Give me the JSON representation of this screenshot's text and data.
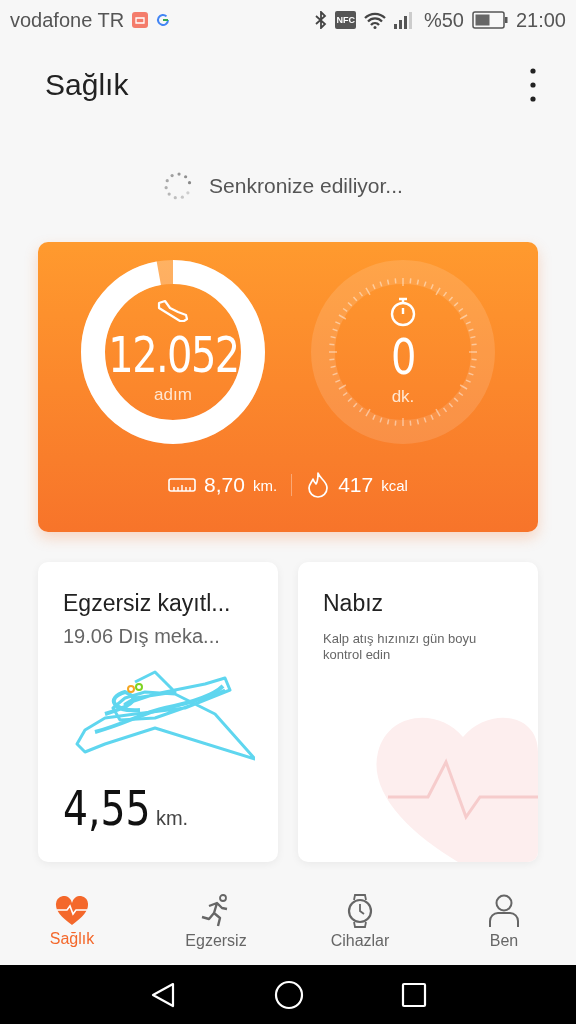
{
  "status_bar": {
    "carrier": "vodafone TR",
    "nfc": "NFC",
    "battery_text": "%50",
    "time": "21:00"
  },
  "header": {
    "title": "Sağlık"
  },
  "sync": {
    "text": "Senkronize ediliyor..."
  },
  "summary": {
    "rings": [
      {
        "kind": "steps",
        "value": "12.052",
        "unit": "adım",
        "level": 0.97
      },
      {
        "kind": "minutes",
        "value": "0",
        "unit": "dk.",
        "level": 0
      }
    ],
    "stats": [
      {
        "kind": "distance",
        "value": "8,70",
        "unit": "km."
      },
      {
        "kind": "calories",
        "value": "417",
        "unit": "kcal"
      }
    ]
  },
  "cards": [
    {
      "kind": "exercise",
      "title": "Egzersiz kayıtl...",
      "subtitle": "19.06 Dış meka...",
      "value": "4,55",
      "unit": "km."
    },
    {
      "kind": "heart",
      "title": "Nabız",
      "description": "Kalp atış hızınızı gün boyu kontrol edin"
    }
  ],
  "tabs": [
    {
      "kind": "heart",
      "label": "Sağlık",
      "selected": true
    },
    {
      "kind": "run",
      "label": "Egzersiz",
      "selected": false
    },
    {
      "kind": "watch",
      "label": "Cihazlar",
      "selected": false
    },
    {
      "kind": "person",
      "label": "Ben",
      "selected": false
    }
  ]
}
